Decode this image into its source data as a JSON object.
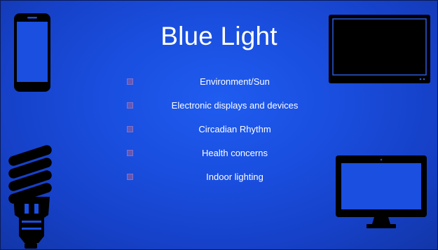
{
  "slide": {
    "title": "Blue Light",
    "bullets": [
      {
        "label": "Environment/Sun"
      },
      {
        "label": "Electronic displays and devices"
      },
      {
        "label": "Circadian Rhythm"
      },
      {
        "label": "Health concerns"
      },
      {
        "label": "Indoor lighting"
      }
    ]
  },
  "icons": [
    "smartphone-icon",
    "television-icon",
    "light-bulb-icon",
    "computer-monitor-icon"
  ],
  "colors": {
    "background": "#1a4fe0",
    "text": "#ffffff",
    "bullet": "#7a5aa8",
    "device": "#000000",
    "screen_outline": "#2a5bd8"
  }
}
